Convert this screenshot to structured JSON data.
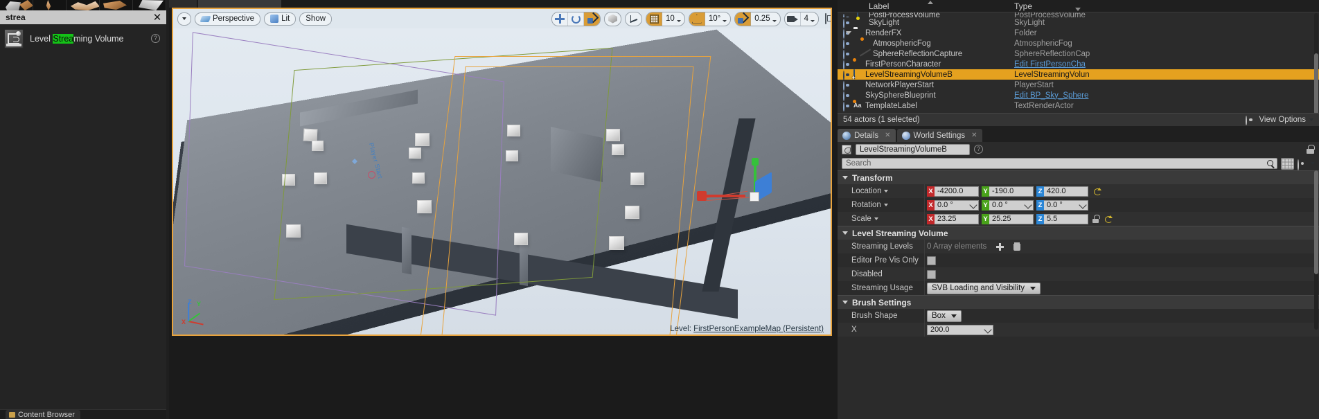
{
  "left_panel": {
    "search_value": "strea",
    "clear_label": "✕",
    "item": {
      "label_before": "Level ",
      "label_match": "Strea",
      "label_after": "ming Volume",
      "help": "?"
    }
  },
  "content_browser": {
    "tab_label": "Content Browser"
  },
  "viewport": {
    "view_menu_caret": "",
    "perspective_label": "Perspective",
    "lit_label": "Lit",
    "show_label": "Show",
    "grid_snap_value": "10",
    "angle_snap_value": "10°",
    "scale_snap_value": "0.25",
    "camera_speed_value": "4",
    "level_label_prefix": "Level:",
    "level_name": "FirstPersonExampleMap (Persistent)",
    "axis_labels": {
      "x": "X",
      "y": "Y",
      "z": "Z"
    },
    "scene_text": "Player Start"
  },
  "outliner": {
    "columns": {
      "label": "Label",
      "type": "Type"
    },
    "rows": [
      {
        "name": "PostProcessVolume",
        "type": "PostProcessVolume",
        "icon": "volume-icon",
        "indent": 28,
        "selected": false,
        "clipped": true
      },
      {
        "name": "SkyLight",
        "type": "SkyLight",
        "icon": "skylight-icon",
        "indent": 28,
        "selected": false
      },
      {
        "name": "RenderFX",
        "type": "Folder",
        "icon": "folder-icon",
        "indent": 23,
        "selected": false,
        "expander": true
      },
      {
        "name": "AtmosphericFog",
        "type": "AtmosphericFog",
        "icon": "fog-icon",
        "indent": 34,
        "selected": false
      },
      {
        "name": "SphereReflectionCapture",
        "type": "SphereReflectionCap",
        "icon": "reflection-capture-icon",
        "indent": 34,
        "selected": false
      },
      {
        "name": "FirstPersonCharacter",
        "type": "Edit FirstPersonCha",
        "icon": "character-icon",
        "indent": 23,
        "selected": false,
        "type_link": true
      },
      {
        "name": "LevelStreamingVolumeB",
        "type": "LevelStreamingVolun",
        "icon": "streaming-volume-icon",
        "indent": 23,
        "selected": true
      },
      {
        "name": "NetworkPlayerStart",
        "type": "PlayerStart",
        "icon": "player-start-icon",
        "indent": 23,
        "selected": false
      },
      {
        "name": "SkySphereBlueprint",
        "type": "Edit BP_Sky_Sphere",
        "icon": "sphere-icon",
        "indent": 23,
        "selected": false,
        "type_link": true
      },
      {
        "name": "TemplateLabel",
        "type": "TextRenderActor",
        "icon": "text-render-icon",
        "indent": 23,
        "selected": false
      }
    ],
    "footer": {
      "count": "54 actors (1 selected)",
      "view_options": "View Options"
    }
  },
  "details": {
    "tabs": [
      {
        "label": "Details",
        "active": true,
        "icon": "info-icon"
      },
      {
        "label": "World Settings",
        "active": false,
        "icon": "globe-icon"
      }
    ],
    "actor_name": "LevelStreamingVolumeB",
    "help": "?",
    "search_placeholder": "Search",
    "sections": [
      {
        "title": "Transform",
        "rows": [
          {
            "label": "Location",
            "has_caret": true,
            "type": "vector",
            "x": "-4200.0",
            "y": "-190.0",
            "z": "420.0",
            "reset": true
          },
          {
            "label": "Rotation",
            "has_caret": true,
            "type": "vector",
            "x": "0.0 °",
            "y": "0.0 °",
            "z": "0.0 °",
            "spinner": true
          },
          {
            "label": "Scale",
            "has_caret": true,
            "type": "vector",
            "x": "23.25",
            "y": "25.25",
            "z": "5.5",
            "lock": true,
            "reset": true
          }
        ]
      },
      {
        "title": "Level Streaming Volume",
        "rows": [
          {
            "label": "Streaming Levels",
            "type": "array",
            "value": "0 Array elements"
          },
          {
            "label": "Editor Pre Vis Only",
            "type": "checkbox",
            "checked": false
          },
          {
            "label": "Disabled",
            "type": "checkbox",
            "checked": false
          },
          {
            "label": "Streaming Usage",
            "type": "combo",
            "value": "SVB Loading and Visibility"
          }
        ]
      },
      {
        "title": "Brush Settings",
        "rows": [
          {
            "label": "Brush Shape",
            "type": "combo",
            "value": "Box"
          },
          {
            "label": "X",
            "type": "number",
            "value": "200.0"
          }
        ]
      }
    ]
  },
  "colors": {
    "accent_orange": "#e5a11f",
    "viewport_border": "#e8a33d",
    "link_blue": "#5b9bd5",
    "axis_x": "#c1282a",
    "axis_y": "#49a21a",
    "axis_z": "#2b86d6",
    "search_highlight": "#14c217",
    "panel_bg": "#2b2b2b"
  }
}
